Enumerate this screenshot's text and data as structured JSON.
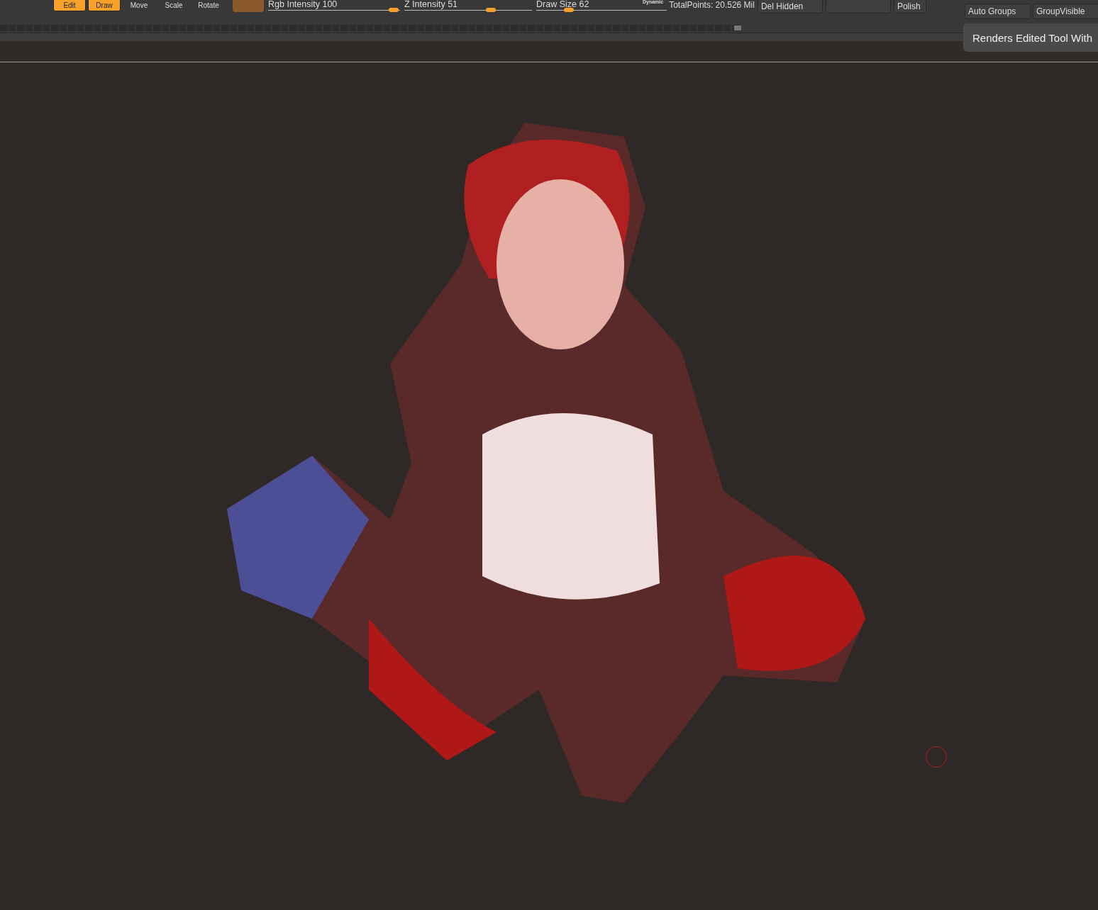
{
  "toolbar": {
    "modes": [
      {
        "label": "Edit",
        "selected": true
      },
      {
        "label": "Draw",
        "selected": true
      },
      {
        "label": "Move",
        "selected": false
      },
      {
        "label": "Scale",
        "selected": false
      },
      {
        "label": "Rotate",
        "selected": false
      }
    ],
    "sliders": [
      {
        "label": "Rgb Intensity",
        "value": "100",
        "level": 0.95
      },
      {
        "label": "Z Intensity",
        "value": "51",
        "level": 0.68
      },
      {
        "label": "Draw Size",
        "value": "62",
        "level": 0.25
      }
    ],
    "dynamic_label": "Dynamic",
    "total_points": "TotalPoints: 20.526 Mil",
    "buttons": [
      "Del Hidden",
      "Polish"
    ],
    "right_buttons": [
      "Auto Groups",
      "GroupVisible"
    ]
  },
  "tooltip": "Renders Edited Tool With"
}
